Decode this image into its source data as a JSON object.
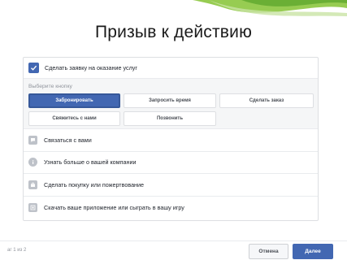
{
  "slide": {
    "title": "Призыв к действию"
  },
  "top_option": {
    "label": "Сделать заявку на оказание услуг",
    "checked": true
  },
  "buttons_section": {
    "label": "Выберите кнопку",
    "options": [
      {
        "label": "Забронировать",
        "selected": true
      },
      {
        "label": "Запросить время",
        "selected": false
      },
      {
        "label": "Сделать заказ",
        "selected": false
      },
      {
        "label": "Свяжитесь с нами",
        "selected": false
      },
      {
        "label": "Позвонить",
        "selected": false
      }
    ]
  },
  "list": [
    {
      "label": "Связаться с вами",
      "icon": "chat-bubble-icon"
    },
    {
      "label": "Узнать больше о вашей компании",
      "icon": "info-icon"
    },
    {
      "label": "Сделать покупку или пожертвование",
      "icon": "shopping-bag-icon"
    },
    {
      "label": "Скачать ваше приложение или сыграть в вашу игру",
      "icon": "app-download-icon"
    }
  ],
  "footer": {
    "step": "аг 1 из 2",
    "cancel": "Отмена",
    "next": "Далее"
  },
  "colors": {
    "accent": "#4267b2",
    "accent_border": "#365899",
    "icon_gray": "#bec2c9",
    "deco_green": "#8cc63f"
  }
}
